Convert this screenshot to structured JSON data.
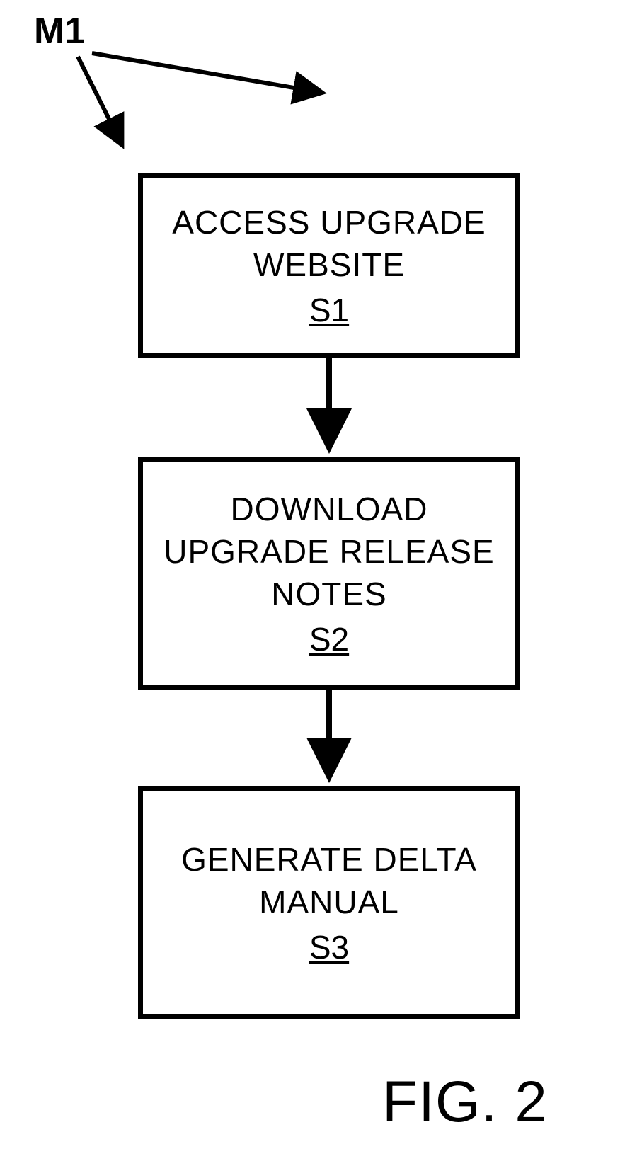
{
  "diagram": {
    "pointer_label": "M1",
    "steps": [
      {
        "title": "ACCESS UPGRADE WEBSITE",
        "code": "S1"
      },
      {
        "title": "DOWNLOAD UPGRADE RELEASE NOTES",
        "code": "S2"
      },
      {
        "title": "GENERATE DELTA MANUAL",
        "code": "S3"
      }
    ],
    "caption": "FIG. 2"
  }
}
